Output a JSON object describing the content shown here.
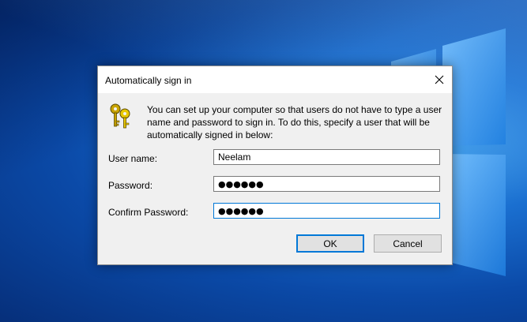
{
  "dialog": {
    "title": "Automatically sign in",
    "description": "You can set up your computer so that users do not have to type a user name and password to sign in. To do this, specify a user that will be automatically signed in below:",
    "fields": {
      "username": {
        "label": "User name:",
        "value": "Neelam"
      },
      "password": {
        "label": "Password:",
        "value": "●●●●●●"
      },
      "confirm_password": {
        "label": "Confirm Password:",
        "value": "●●●●●●"
      }
    },
    "buttons": {
      "ok": "OK",
      "cancel": "Cancel"
    }
  },
  "icons": {
    "close": "close-icon",
    "keys": "keys-icon",
    "desktop_logo": "windows-logo"
  },
  "colors": {
    "accent": "#0078d7",
    "desktop": "#0b4aa8"
  }
}
